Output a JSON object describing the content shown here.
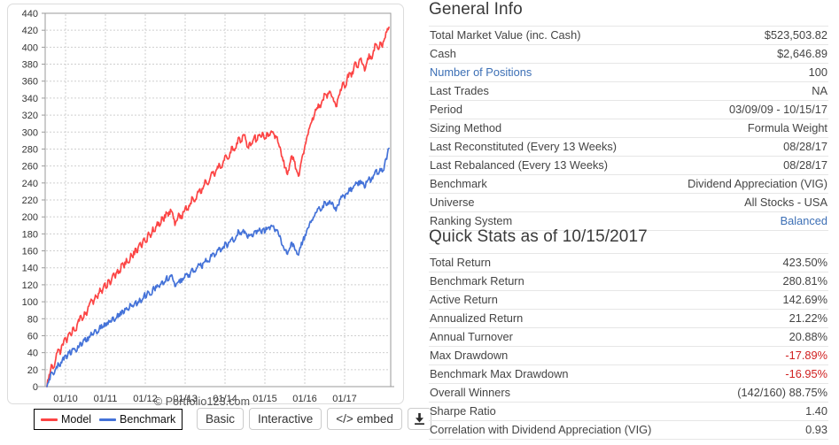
{
  "chart": {
    "copyright": "© Portfolio123.com",
    "legend": [
      {
        "label": "Model",
        "color": "#fc4444"
      },
      {
        "label": "Benchmark",
        "color": "#4472d8"
      }
    ],
    "buttons": [
      {
        "name": "basic",
        "label": "Basic"
      },
      {
        "name": "interactive",
        "label": "Interactive"
      },
      {
        "name": "embed",
        "label": "</> embed"
      },
      {
        "name": "download",
        "label": "download-icon"
      }
    ]
  },
  "chart_data": {
    "type": "line",
    "title": "",
    "xlabel": "",
    "ylabel": "",
    "ylim": [
      0,
      440
    ],
    "yticks": [
      0,
      20,
      40,
      60,
      80,
      100,
      120,
      140,
      160,
      180,
      200,
      220,
      240,
      260,
      280,
      300,
      320,
      340,
      360,
      380,
      400,
      420,
      440
    ],
    "xticks": [
      "01/10",
      "01/11",
      "01/12",
      "01/13",
      "01/14",
      "01/15",
      "01/16",
      "01/17"
    ],
    "xlim": [
      "03/09/09",
      "10/15/17"
    ],
    "grid": true,
    "legend_position": "bottom-left",
    "series": [
      {
        "name": "Model",
        "color": "#fc4444",
        "values": [
          0,
          14,
          26,
          22,
          33,
          44,
          38,
          50,
          57,
          52,
          63,
          60,
          70,
          66,
          76,
          83,
          78,
          88,
          84,
          95,
          103,
          97,
          108,
          104,
          116,
          110,
          121,
          116,
          126,
          122,
          133,
          128,
          138,
          134,
          145,
          140,
          151,
          146,
          157,
          152,
          163,
          158,
          169,
          164,
          175,
          170,
          182,
          176,
          188,
          183,
          194,
          189,
          200,
          195,
          206,
          201,
          209,
          204,
          190,
          196,
          203,
          198,
          206,
          213,
          208,
          216,
          223,
          218,
          226,
          232,
          228,
          236,
          243,
          238,
          246,
          252,
          248,
          256,
          263,
          258,
          266,
          273,
          268,
          276,
          283,
          278,
          287,
          294,
          289,
          297,
          292,
          282,
          288,
          286,
          295,
          290,
          296,
          294,
          298,
          293,
          299,
          296,
          300,
          297,
          294,
          286,
          278,
          266,
          258,
          250,
          262,
          272,
          266,
          256,
          248,
          262,
          274,
          285,
          296,
          305,
          312,
          318,
          326,
          333,
          329,
          338,
          345,
          340,
          348,
          342,
          336,
          330,
          340,
          350,
          358,
          352,
          362,
          370,
          365,
          374,
          382,
          376,
          386,
          380,
          372,
          382,
          392,
          386,
          396,
          404,
          398,
          406,
          400,
          410,
          418,
          423.5
        ]
      },
      {
        "name": "Benchmark",
        "color": "#4472d8",
        "values": [
          0,
          9,
          17,
          14,
          21,
          28,
          24,
          32,
          36,
          33,
          40,
          38,
          44,
          42,
          48,
          52,
          49,
          55,
          53,
          59,
          64,
          61,
          67,
          64,
          72,
          69,
          75,
          72,
          78,
          76,
          82,
          79,
          86,
          83,
          90,
          87,
          93,
          90,
          97,
          94,
          100,
          97,
          104,
          101,
          108,
          105,
          112,
          108,
          116,
          113,
          120,
          117,
          124,
          121,
          128,
          125,
          130,
          127,
          118,
          122,
          126,
          123,
          128,
          132,
          129,
          134,
          139,
          135,
          140,
          144,
          141,
          146,
          151,
          147,
          152,
          157,
          153,
          159,
          164,
          160,
          165,
          170,
          166,
          171,
          176,
          172,
          178,
          183,
          179,
          185,
          181,
          175,
          179,
          177,
          183,
          180,
          184,
          182,
          186,
          183,
          187,
          185,
          189,
          186,
          184,
          179,
          174,
          166,
          161,
          156,
          163,
          170,
          166,
          160,
          155,
          164,
          172,
          179,
          186,
          192,
          196,
          200,
          205,
          210,
          207,
          213,
          218,
          214,
          219,
          215,
          211,
          207,
          214,
          221,
          226,
          222,
          228,
          234,
          230,
          236,
          241,
          237,
          243,
          239,
          234,
          241,
          247,
          243,
          249,
          255,
          251,
          257,
          253,
          261,
          268,
          280.81
        ]
      }
    ]
  },
  "general_info": {
    "title": "General Info",
    "rows": [
      {
        "label": "Total Market Value (inc. Cash)",
        "value": "$523,503.82",
        "label_link": false,
        "value_link": false
      },
      {
        "label": "Cash",
        "value": "$2,646.89",
        "label_link": false,
        "value_link": false
      },
      {
        "label": "Number of Positions",
        "value": "100",
        "label_link": true,
        "value_link": false
      },
      {
        "label": "Last Trades",
        "value": "NA",
        "label_link": false,
        "value_link": false
      },
      {
        "label": "Period",
        "value": "03/09/09 - 10/15/17",
        "label_link": false,
        "value_link": false
      },
      {
        "label": "Sizing Method",
        "value": "Formula Weight",
        "label_link": false,
        "value_link": false
      },
      {
        "label": "Last Reconstituted (Every 13 Weeks)",
        "value": "08/28/17",
        "label_link": false,
        "value_link": false
      },
      {
        "label": "Last Rebalanced (Every 13 Weeks)",
        "value": "08/28/17",
        "label_link": false,
        "value_link": false
      },
      {
        "label": "Benchmark",
        "value": "Dividend Appreciation (VIG)",
        "label_link": false,
        "value_link": false
      },
      {
        "label": "Universe",
        "value": "All Stocks - USA",
        "label_link": false,
        "value_link": false
      },
      {
        "label": "Ranking System",
        "value": "Balanced",
        "label_link": false,
        "value_link": true
      }
    ]
  },
  "quick_stats": {
    "title": "Quick Stats as of 10/15/2017",
    "rows": [
      {
        "label": "Total Return",
        "value": "423.50%",
        "negative": false
      },
      {
        "label": "Benchmark Return",
        "value": "280.81%",
        "negative": false
      },
      {
        "label": "Active Return",
        "value": "142.69%",
        "negative": false
      },
      {
        "label": "Annualized Return",
        "value": "21.22%",
        "negative": false
      },
      {
        "label": "Annual Turnover",
        "value": "20.88%",
        "negative": false
      },
      {
        "label": "Max Drawdown",
        "value": "-17.89%",
        "negative": true
      },
      {
        "label": "Benchmark Max Drawdown",
        "value": "-16.95%",
        "negative": true
      },
      {
        "label": "Overall Winners",
        "value": "(142/160) 88.75%",
        "negative": false
      },
      {
        "label": "Sharpe Ratio",
        "value": "1.40",
        "negative": false
      },
      {
        "label": "Correlation with Dividend Appreciation (VIG)",
        "value": "0.93",
        "negative": false
      }
    ]
  }
}
